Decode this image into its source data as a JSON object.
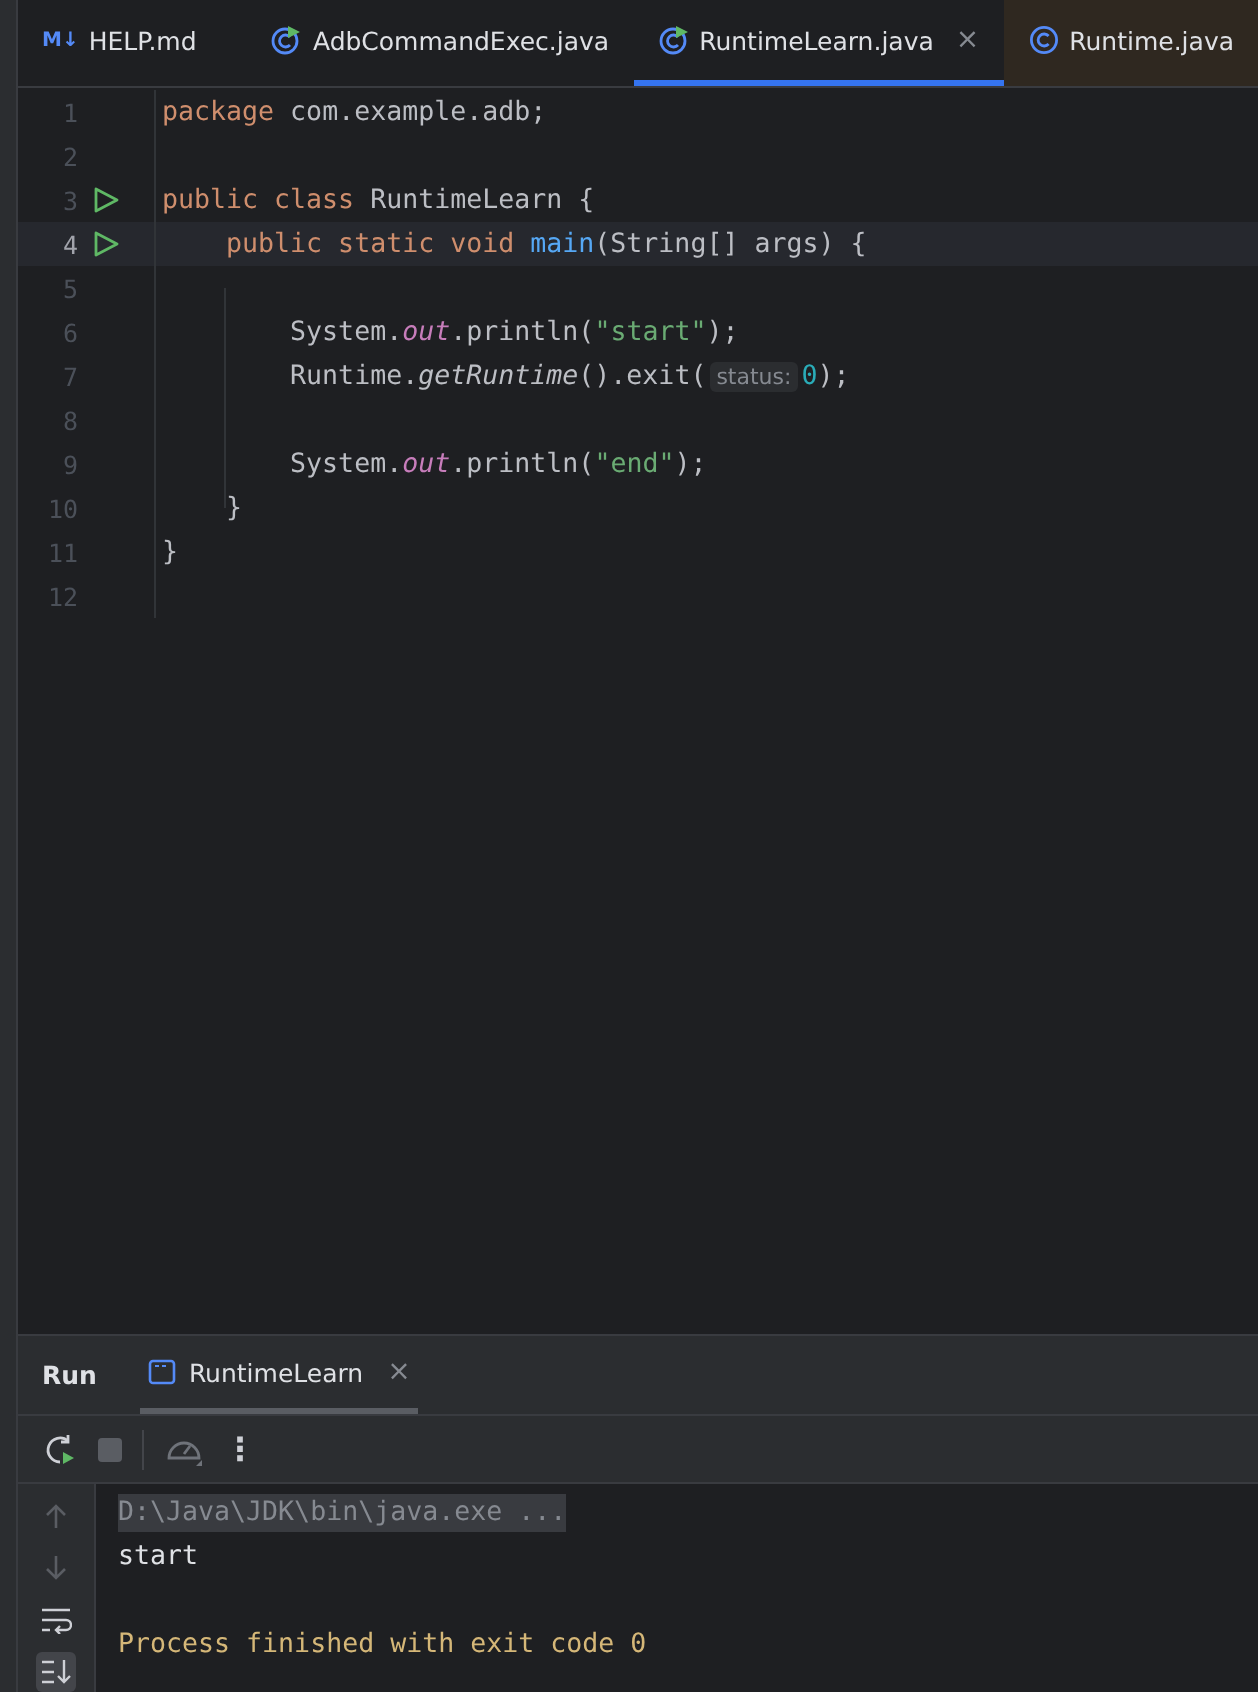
{
  "tabs": [
    {
      "label": "HELP.md",
      "kind": "markdown",
      "badge": "M↓",
      "selected": false,
      "library": false
    },
    {
      "label": "AdbCommandExec.java",
      "kind": "class-run",
      "selected": false,
      "library": false
    },
    {
      "label": "RuntimeLearn.java",
      "kind": "class-run",
      "selected": true,
      "library": false,
      "close": "×"
    },
    {
      "label": "Runtime.java",
      "kind": "class",
      "selected": false,
      "library": true
    }
  ],
  "editor": {
    "lines": [
      {
        "number": "1",
        "run_marker": false,
        "current": false,
        "tokens": [
          {
            "kind": "keyword",
            "text": "package"
          },
          {
            "kind": "plain",
            "text": " com.example.adb;"
          }
        ]
      },
      {
        "number": "2",
        "run_marker": false,
        "current": false
      },
      {
        "number": "3",
        "run_marker": true,
        "current": false,
        "tokens": [
          {
            "kind": "keyword",
            "text": "public class"
          },
          {
            "kind": "plain",
            "text": " RuntimeLearn {"
          }
        ]
      },
      {
        "number": "4",
        "run_marker": true,
        "current": true,
        "tokens": [
          {
            "kind": "keyword",
            "text": "    public static void"
          },
          {
            "kind": "function",
            "text": " main"
          },
          {
            "kind": "plain",
            "text": "(String[] args) {"
          }
        ]
      },
      {
        "number": "5",
        "run_marker": false,
        "current": false
      },
      {
        "number": "6",
        "run_marker": false,
        "current": false,
        "tokens": [
          {
            "kind": "plain",
            "text": "        System."
          },
          {
            "kind": "field",
            "text": "out"
          },
          {
            "kind": "plain",
            "text": ".println("
          },
          {
            "kind": "string",
            "text": "\"start\""
          },
          {
            "kind": "plain",
            "text": ");"
          }
        ]
      },
      {
        "number": "7",
        "run_marker": false,
        "current": false,
        "tokens": [
          {
            "kind": "plain",
            "text": "        Runtime."
          },
          {
            "kind": "static",
            "text": "getRuntime"
          },
          {
            "kind": "plain",
            "text": "().exit("
          },
          {
            "kind": "hint",
            "text": "status:"
          },
          {
            "kind": "number",
            "text": "0"
          },
          {
            "kind": "plain",
            "text": ");"
          }
        ]
      },
      {
        "number": "8",
        "run_marker": false,
        "current": false
      },
      {
        "number": "9",
        "run_marker": false,
        "current": false,
        "tokens": [
          {
            "kind": "plain",
            "text": "        System."
          },
          {
            "kind": "field",
            "text": "out"
          },
          {
            "kind": "plain",
            "text": ".println("
          },
          {
            "kind": "string",
            "text": "\"end\""
          },
          {
            "kind": "plain",
            "text": ");"
          }
        ]
      },
      {
        "number": "10",
        "run_marker": false,
        "current": false,
        "tokens": [
          {
            "kind": "plain",
            "text": "    }"
          }
        ]
      },
      {
        "number": "11",
        "run_marker": false,
        "current": false,
        "tokens": [
          {
            "kind": "plain",
            "text": "}"
          }
        ]
      },
      {
        "number": "12",
        "run_marker": false,
        "current": false
      }
    ]
  },
  "run_panel": {
    "title": "Run",
    "tabs": [
      {
        "label": "RuntimeLearn",
        "selected": true,
        "close": "×"
      }
    ],
    "toolbar": [
      {
        "kind": "rerun"
      },
      {
        "kind": "stop"
      },
      {
        "kind": "profiler"
      },
      {
        "kind": "more",
        "text": "⋮"
      }
    ],
    "side_tools": [
      {
        "kind": "up",
        "selected": false
      },
      {
        "kind": "down",
        "selected": false
      },
      {
        "kind": "wrap",
        "selected": false
      },
      {
        "kind": "scroll-end",
        "selected": true
      }
    ],
    "console": [
      {
        "kind": "command",
        "text": "D:\\Java\\JDK\\bin\\java.exe ..."
      },
      {
        "kind": "output",
        "text": "start"
      },
      {
        "kind": "blank"
      },
      {
        "kind": "system",
        "text": "Process finished with exit code 0"
      }
    ]
  }
}
